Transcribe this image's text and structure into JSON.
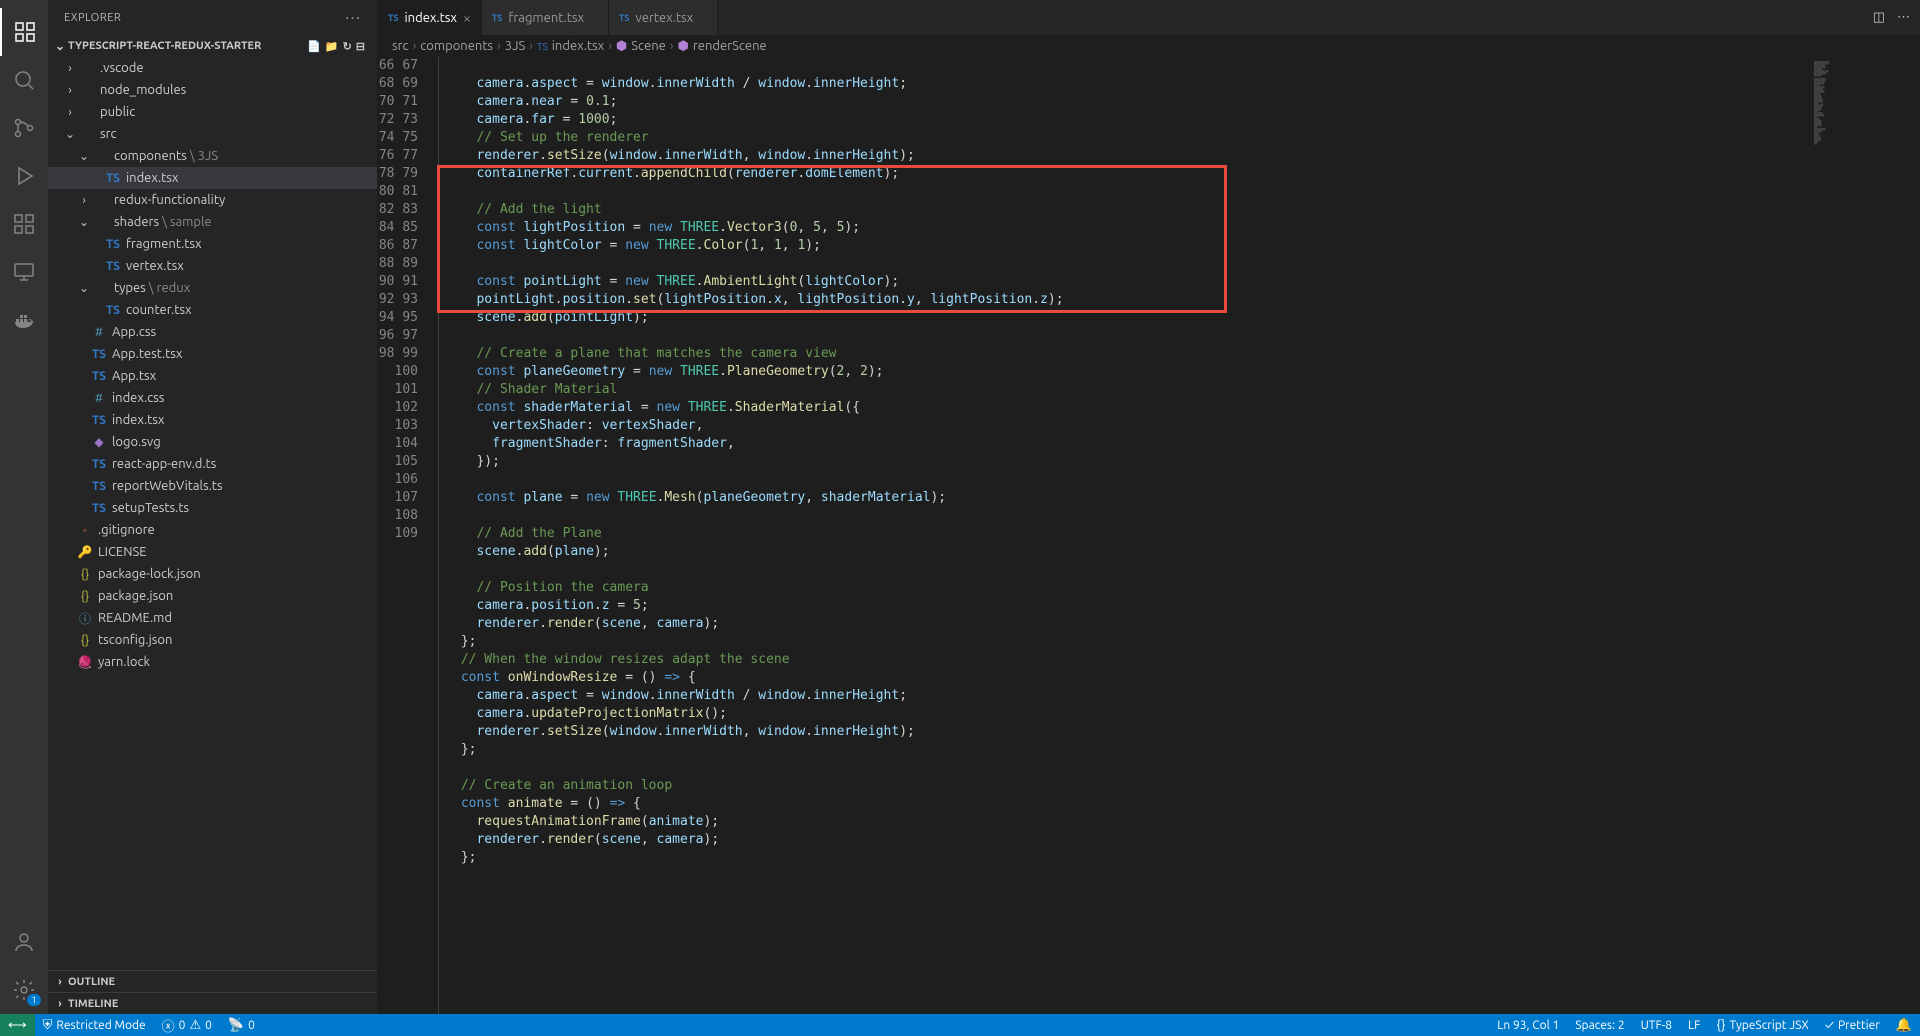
{
  "explorer": {
    "title": "EXPLORER",
    "project": "TYPESCRIPT-REACT-REDUX-STARTER"
  },
  "tree": {
    "vscode": ".vscode",
    "node_modules": "node_modules",
    "public": "public",
    "src": "src",
    "components": "components",
    "components_suffix": "3JS",
    "index_tsx": "index.tsx",
    "redux_func": "redux-functionality",
    "shaders": "shaders",
    "shaders_suffix": "sample",
    "fragment": "fragment.tsx",
    "vertex": "vertex.tsx",
    "types": "types",
    "types_suffix": "redux",
    "counter": "counter.tsx",
    "app_css": "App.css",
    "app_test": "App.test.tsx",
    "app_tsx": "App.tsx",
    "index_css": "index.css",
    "src_index_tsx": "index.tsx",
    "logo": "logo.svg",
    "react_env": "react-app-env.d.ts",
    "report": "reportWebVitals.ts",
    "setup": "setupTests.ts",
    "gitignore": ".gitignore",
    "license": "LICENSE",
    "pkg_lock": "package-lock.json",
    "pkg": "package.json",
    "readme": "README.md",
    "tsconfig": "tsconfig.json",
    "yarn": "yarn.lock"
  },
  "sections": {
    "outline": "OUTLINE",
    "timeline": "TIMELINE"
  },
  "tabs": [
    {
      "label": "index.tsx",
      "active": true
    },
    {
      "label": "fragment.tsx",
      "active": false
    },
    {
      "label": "vertex.tsx",
      "active": false
    }
  ],
  "breadcrumbs": {
    "p0": "src",
    "p1": "components",
    "p2": "3JS",
    "p3": "index.tsx",
    "p4": "Scene",
    "p5": "renderScene"
  },
  "line_start": 66,
  "line_end": 109,
  "status": {
    "restricted": "Restricted Mode",
    "errors": "0",
    "warnings": "0",
    "ports": "0",
    "cursor": "Ln 93, Col 1",
    "spaces": "Spaces: 2",
    "encoding": "UTF-8",
    "eol": "LF",
    "lang": "TypeScript JSX",
    "prettier": "Prettier"
  },
  "badge_count": "1"
}
